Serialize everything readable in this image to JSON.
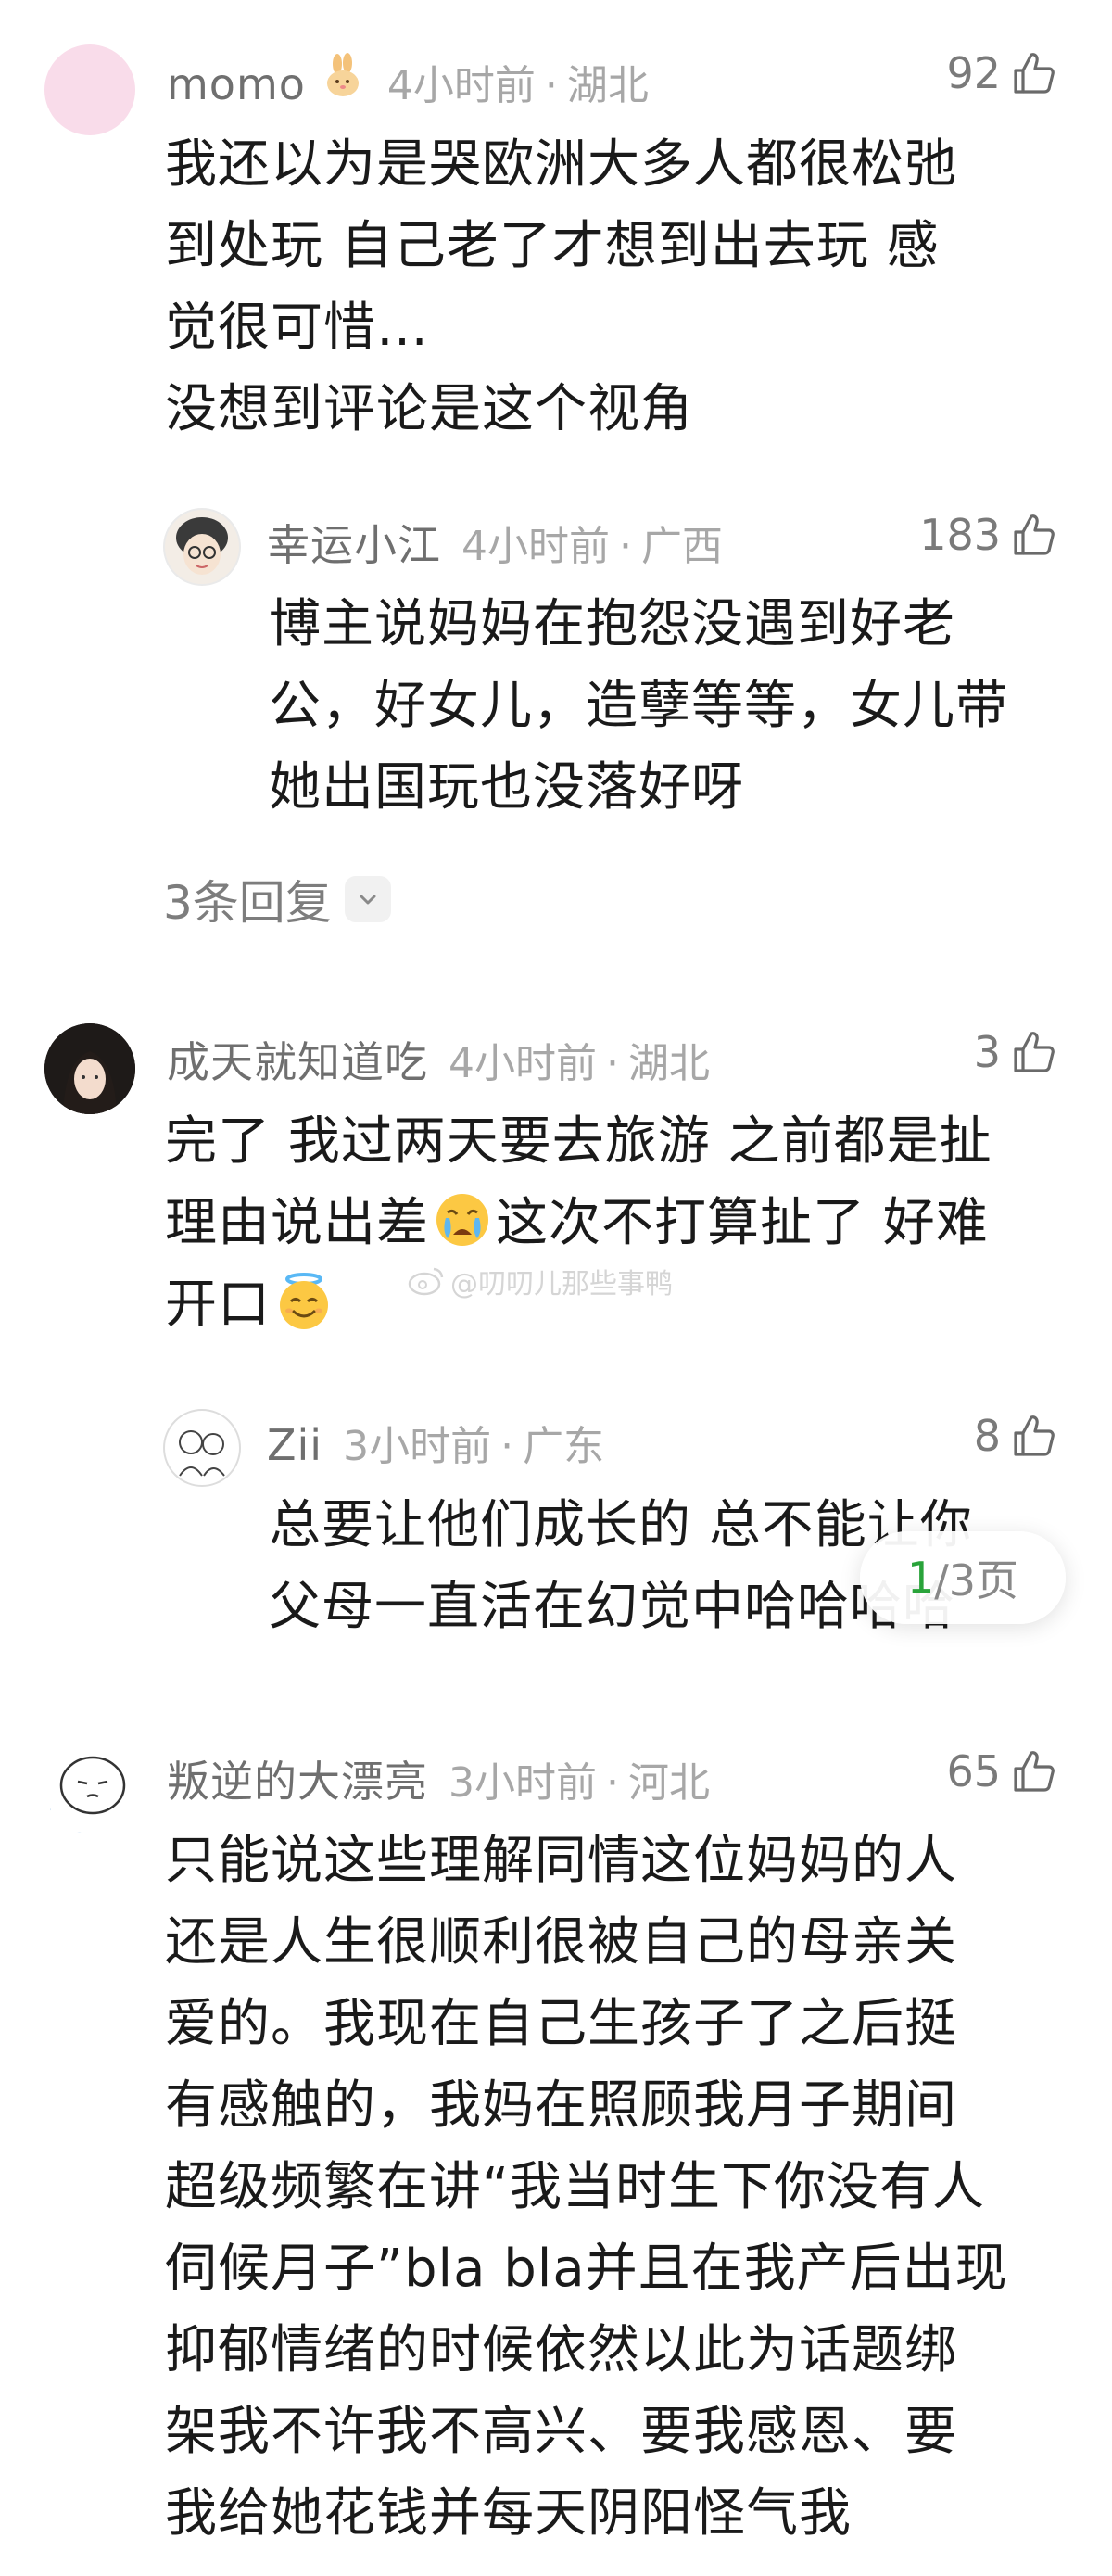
{
  "comments": [
    {
      "user": "momo",
      "time": "4小时前",
      "dot": "·",
      "location": "湖北",
      "likes": "92",
      "text": "我还以为是哭欧洲大多人都很松弛\n到处玩  自己老了才想到出去玩  感\n觉很可惜…\n没想到评论是这个视角",
      "reply": {
        "user": "幸运小江",
        "time": "4小时前",
        "dot": "·",
        "location": "广西",
        "likes": "183",
        "text": "博主说妈妈在抱怨没遇到好老\n公，好女儿，造孽等等，女儿带\n她出国玩也没落好呀"
      },
      "replies_label": "3条回复"
    },
    {
      "user": "成天就知道吃",
      "time": "4小时前",
      "dot": "·",
      "location": "湖北",
      "likes": "3",
      "text_line1": "完了 我过两天要去旅游 之前都是扯",
      "text_line2a": "理由说出差",
      "text_line2b": "这次不打算扯了 好难",
      "text_line3": "开口",
      "reply": {
        "user": "Zii",
        "time": "3小时前",
        "dot": "·",
        "location": "广东",
        "likes": "8",
        "text": "总要让他们成长的 总不能让你\n父母一直活在幻觉中哈哈哈哈"
      }
    },
    {
      "user": "叛逆的大漂亮",
      "time": "3小时前",
      "dot": "·",
      "location": "河北",
      "likes": "65",
      "text": "只能说这些理解同情这位妈妈的人\n还是人生很顺利很被自己的母亲关\n爱的。我现在自己生孩子了之后挺\n有感触的，我妈在照顾我月子期间\n超级频繁在讲“我当时生下你没有人\n伺候月子”bla bla并且在我产后出现\n抑郁情绪的时候依然以此为话题绑\n架我不许我不高兴、要我感恩、要\n我给她花钱并每天阴阳怪气我"
    }
  ],
  "watermark": "@叨叨儿那些事鸭",
  "pager": {
    "current": "1",
    "total": "/3页"
  },
  "colors": {
    "page_current": "#29a33a",
    "muted": "#a7a7a7"
  },
  "icons": [
    "like-icon",
    "chevron-down-icon",
    "rabbit-emoji",
    "crying-emoji",
    "halo-smile-emoji",
    "weibo-icon"
  ]
}
